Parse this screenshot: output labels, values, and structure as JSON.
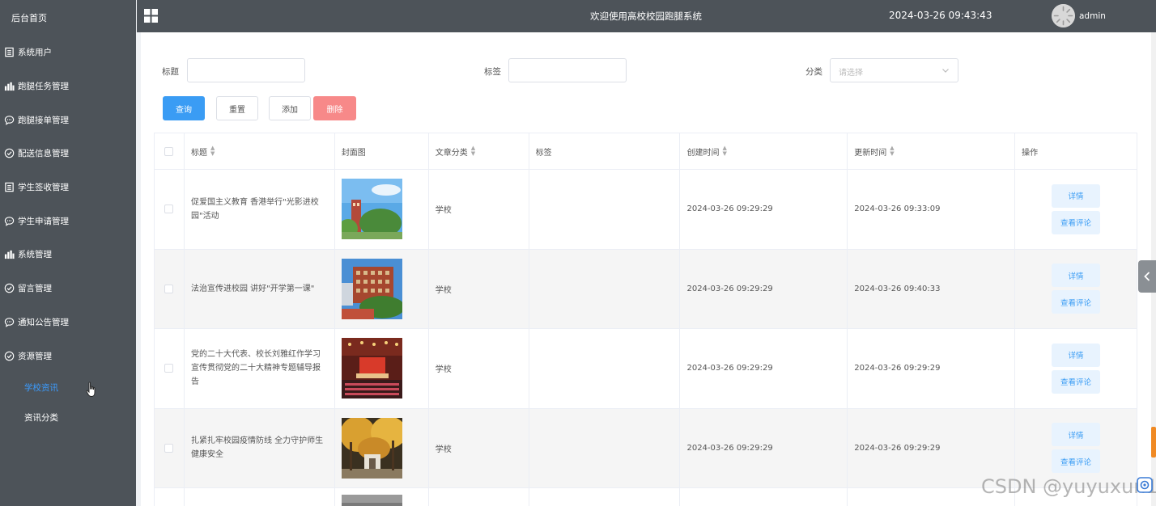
{
  "sidebar": {
    "home": "后台首页",
    "items": [
      {
        "label": "系统用户",
        "icon": "document-icon"
      },
      {
        "label": "跑腿任务管理",
        "icon": "bar-chart-icon"
      },
      {
        "label": "跑腿接单管理",
        "icon": "chat-icon"
      },
      {
        "label": "配送信息管理",
        "icon": "check-circle-icon"
      },
      {
        "label": "学生签收管理",
        "icon": "document-icon"
      },
      {
        "label": "学生申请管理",
        "icon": "chat-icon"
      },
      {
        "label": "系统管理",
        "icon": "bar-chart-icon"
      },
      {
        "label": "留言管理",
        "icon": "check-circle-icon"
      },
      {
        "label": "通知公告管理",
        "icon": "chat-icon"
      },
      {
        "label": "资源管理",
        "icon": "check-circle-icon"
      }
    ],
    "sub_items": [
      {
        "label": "学校资讯",
        "active": true
      },
      {
        "label": "资讯分类",
        "active": false
      }
    ]
  },
  "header": {
    "title": "欢迎使用高校校园跑腿系统",
    "datetime": "2024-03-26 09:43:43",
    "username": "admin"
  },
  "filters": {
    "title_label": "标题",
    "tag_label": "标签",
    "category_label": "分类",
    "category_placeholder": "请选择"
  },
  "buttons": {
    "search": "查询",
    "reset": "重置",
    "add": "添加",
    "delete": "删除"
  },
  "table": {
    "headers": [
      "标题",
      "封面图",
      "文章分类",
      "标签",
      "创建时间",
      "更新时间",
      "操作"
    ],
    "rows": [
      {
        "title": "促爱国主义教育 香港举行\"光影进校园\"活动",
        "category": "学校",
        "tags": "",
        "created": "2024-03-26 09:29:29",
        "updated": "2024-03-26 09:33:09"
      },
      {
        "title": "法治宣传进校园 讲好\"开学第一课\"",
        "category": "学校",
        "tags": "",
        "created": "2024-03-26 09:29:29",
        "updated": "2024-03-26 09:40:33"
      },
      {
        "title": "党的二十大代表、校长刘雅红作学习宣传贯彻党的二十大精神专题辅导报告",
        "category": "学校",
        "tags": "",
        "created": "2024-03-26 09:29:29",
        "updated": "2024-03-26 09:29:29"
      },
      {
        "title": "扎紧扎牢校园疫情防线 全力守护师生健康安全",
        "category": "学校",
        "tags": "",
        "created": "2024-03-26 09:29:29",
        "updated": "2024-03-26 09:29:29"
      }
    ],
    "row_actions": {
      "detail": "详情",
      "comments": "查看评论"
    }
  },
  "watermark": "CSDN @yuyuxun1",
  "colors": {
    "sidebar_bg": "#4d5359",
    "primary": "#3a9cf4",
    "danger": "#f78989",
    "active_link": "#3b9cff"
  }
}
